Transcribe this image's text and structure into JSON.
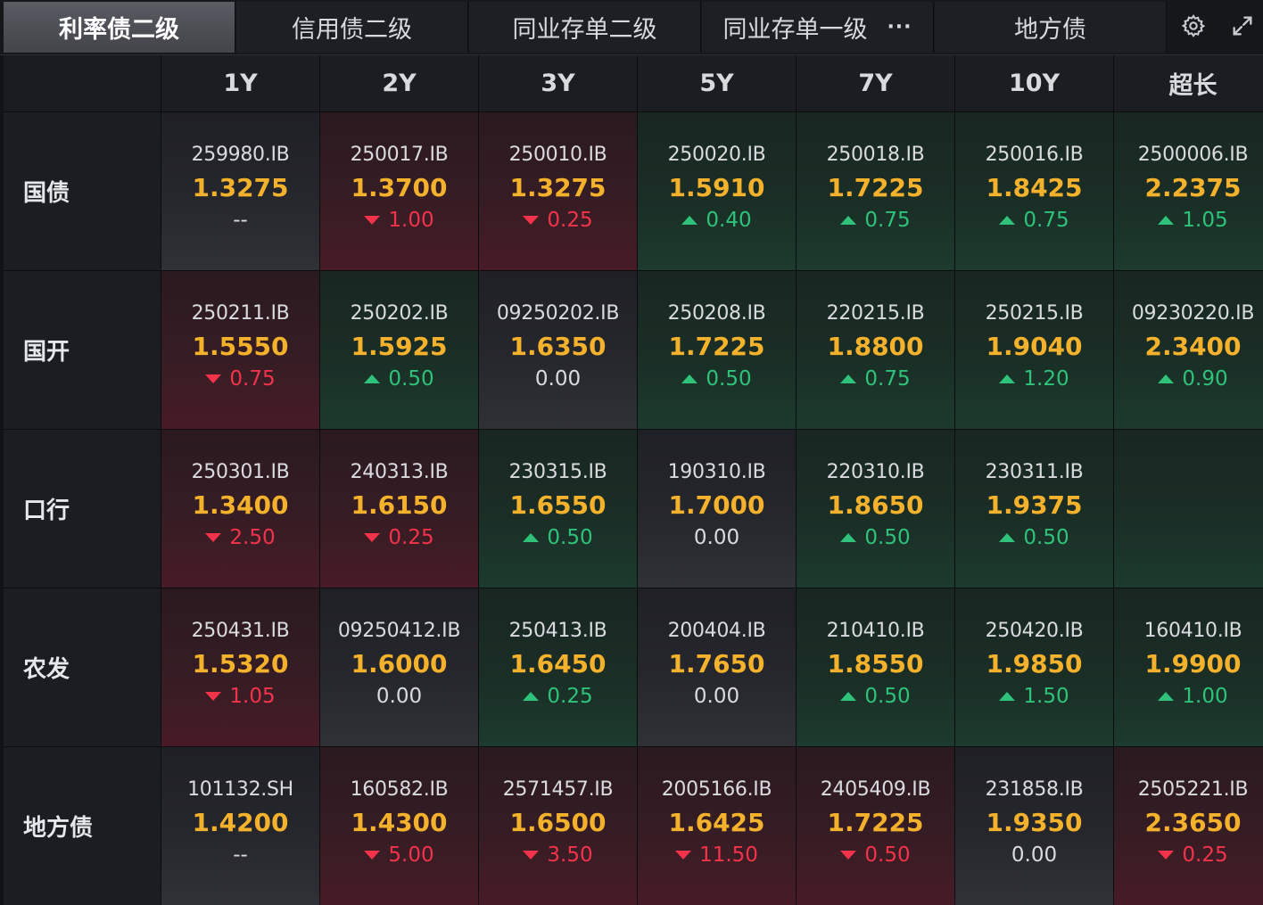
{
  "tabs": [
    {
      "label": "利率债二级",
      "active": true
    },
    {
      "label": "信用债二级",
      "active": false
    },
    {
      "label": "同业存单二级",
      "active": false
    },
    {
      "label": "同业存单一级",
      "active": false,
      "more": "···"
    },
    {
      "label": "地方债",
      "active": false
    }
  ],
  "tools": {
    "settings_icon": "gear-icon",
    "expand_icon": "expand-icon"
  },
  "columns": [
    "1Y",
    "2Y",
    "3Y",
    "5Y",
    "7Y",
    "10Y",
    "超长"
  ],
  "rows": [
    {
      "label": "国债",
      "cells": [
        {
          "code": "259980.IB",
          "price": "1.3275",
          "change": "--",
          "dir": "na"
        },
        {
          "code": "250017.IB",
          "price": "1.3700",
          "change": "1.00",
          "dir": "down"
        },
        {
          "code": "250010.IB",
          "price": "1.3275",
          "change": "0.25",
          "dir": "down"
        },
        {
          "code": "250020.IB",
          "price": "1.5910",
          "change": "0.40",
          "dir": "up"
        },
        {
          "code": "250018.IB",
          "price": "1.7225",
          "change": "0.75",
          "dir": "up"
        },
        {
          "code": "250016.IB",
          "price": "1.8425",
          "change": "0.75",
          "dir": "up"
        },
        {
          "code": "2500006.IB",
          "price": "2.2375",
          "change": "1.05",
          "dir": "up"
        }
      ]
    },
    {
      "label": "国开",
      "cells": [
        {
          "code": "250211.IB",
          "price": "1.5550",
          "change": "0.75",
          "dir": "down"
        },
        {
          "code": "250202.IB",
          "price": "1.5925",
          "change": "0.50",
          "dir": "up"
        },
        {
          "code": "09250202.IB",
          "price": "1.6350",
          "change": "0.00",
          "dir": "flat"
        },
        {
          "code": "250208.IB",
          "price": "1.7225",
          "change": "0.50",
          "dir": "up"
        },
        {
          "code": "220215.IB",
          "price": "1.8800",
          "change": "0.75",
          "dir": "up"
        },
        {
          "code": "250215.IB",
          "price": "1.9040",
          "change": "1.20",
          "dir": "up"
        },
        {
          "code": "09230220.IB",
          "price": "2.3400",
          "change": "0.90",
          "dir": "up"
        }
      ]
    },
    {
      "label": "口行",
      "cells": [
        {
          "code": "250301.IB",
          "price": "1.3400",
          "change": "2.50",
          "dir": "down"
        },
        {
          "code": "240313.IB",
          "price": "1.6150",
          "change": "0.25",
          "dir": "down"
        },
        {
          "code": "230315.IB",
          "price": "1.6550",
          "change": "0.50",
          "dir": "up"
        },
        {
          "code": "190310.IB",
          "price": "1.7000",
          "change": "0.00",
          "dir": "flat"
        },
        {
          "code": "220310.IB",
          "price": "1.8650",
          "change": "0.50",
          "dir": "up"
        },
        {
          "code": "230311.IB",
          "price": "1.9375",
          "change": "0.50",
          "dir": "up"
        },
        {
          "code": "",
          "price": "",
          "change": "",
          "dir": "empty"
        }
      ]
    },
    {
      "label": "农发",
      "cells": [
        {
          "code": "250431.IB",
          "price": "1.5320",
          "change": "1.05",
          "dir": "down"
        },
        {
          "code": "09250412.IB",
          "price": "1.6000",
          "change": "0.00",
          "dir": "flat"
        },
        {
          "code": "250413.IB",
          "price": "1.6450",
          "change": "0.25",
          "dir": "up"
        },
        {
          "code": "200404.IB",
          "price": "1.7650",
          "change": "0.00",
          "dir": "flat"
        },
        {
          "code": "210410.IB",
          "price": "1.8550",
          "change": "0.50",
          "dir": "up"
        },
        {
          "code": "250420.IB",
          "price": "1.9850",
          "change": "1.50",
          "dir": "up"
        },
        {
          "code": "160410.IB",
          "price": "1.9900",
          "change": "1.00",
          "dir": "up"
        }
      ]
    },
    {
      "label": "地方债",
      "cells": [
        {
          "code": "101132.SH",
          "price": "1.4200",
          "change": "--",
          "dir": "na"
        },
        {
          "code": "160582.IB",
          "price": "1.4300",
          "change": "5.00",
          "dir": "down"
        },
        {
          "code": "2571457.IB",
          "price": "1.6500",
          "change": "3.50",
          "dir": "down"
        },
        {
          "code": "2005166.IB",
          "price": "1.6425",
          "change": "11.50",
          "dir": "down"
        },
        {
          "code": "2405409.IB",
          "price": "1.7225",
          "change": "0.50",
          "dir": "down"
        },
        {
          "code": "231858.IB",
          "price": "1.9350",
          "change": "0.00",
          "dir": "flat"
        },
        {
          "code": "2505221.IB",
          "price": "2.3650",
          "change": "0.25",
          "dir": "down"
        }
      ]
    }
  ],
  "colors": {
    "up": "#2ec27a",
    "down": "#f2334a",
    "price": "#f4b22c"
  }
}
